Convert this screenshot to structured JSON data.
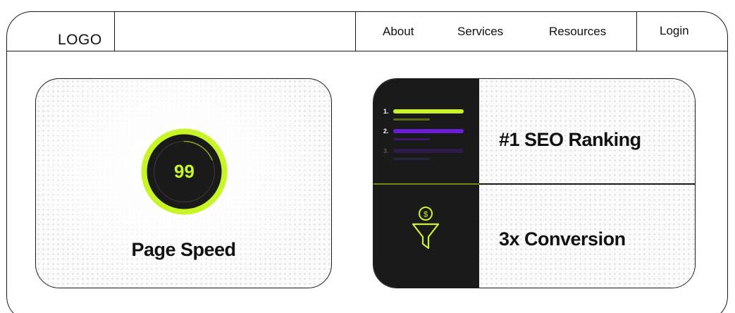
{
  "nav": {
    "logo": "LOGO",
    "links": [
      "About",
      "Services",
      "Resources"
    ],
    "login": "Login"
  },
  "speed_card": {
    "score": "99",
    "label": "Page Speed"
  },
  "features": {
    "seo": {
      "label": "#1 SEO Ranking",
      "ranks": [
        "1.",
        "2.",
        "3."
      ]
    },
    "conversion": {
      "label": "3x Conversion",
      "icon": "funnel-dollar-icon"
    }
  },
  "colors": {
    "accent": "#c8f526",
    "purple": "#6c1bd8",
    "dark": "#1a1a1a"
  }
}
